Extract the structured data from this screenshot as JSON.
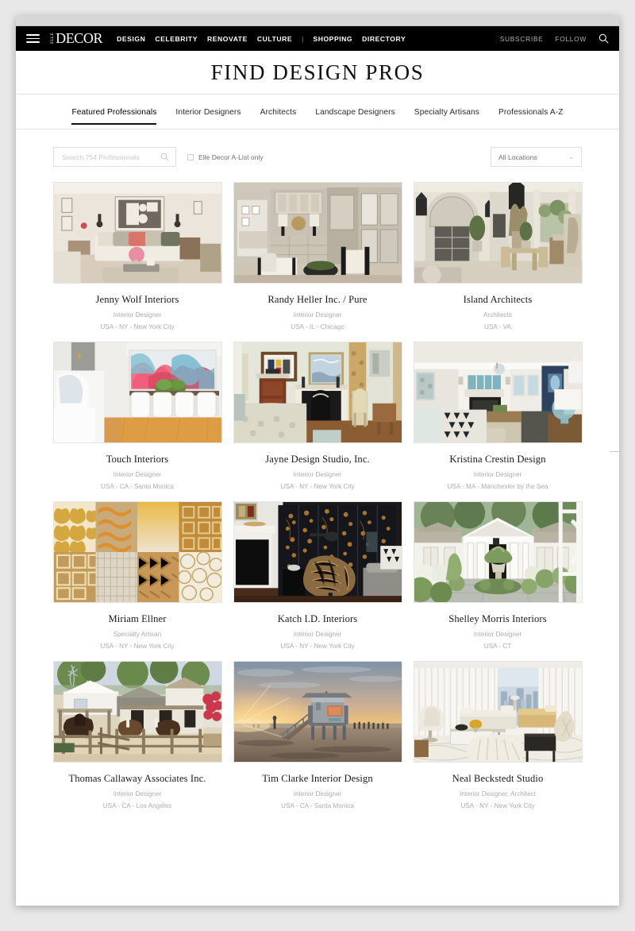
{
  "site": {
    "logo_primary": "DECOR",
    "logo_secondary": "ELLE",
    "menu_icon": "hamburger-icon",
    "search_icon": "search-icon"
  },
  "nav": {
    "links": [
      "DESIGN",
      "CELEBRITY",
      "RENOVATE",
      "CULTURE",
      "SHOPPING",
      "DIRECTORY"
    ],
    "divider": "|",
    "subscribe": "SUBSCRIBE",
    "follow": "FOLLOW"
  },
  "hero": {
    "title": "FIND DESIGN PROS"
  },
  "tabs": [
    {
      "label": "Featured Professionals",
      "active": true
    },
    {
      "label": "Interior Designers",
      "active": false
    },
    {
      "label": "Architects",
      "active": false
    },
    {
      "label": "Landscape Designers",
      "active": false
    },
    {
      "label": "Specialty Artisans",
      "active": false
    },
    {
      "label": "Professionals A-Z",
      "active": false
    }
  ],
  "filters": {
    "search_placeholder": "Search 754 Professionals",
    "search_value": "",
    "checkbox_label": "Elle Decor A-List only",
    "checkbox_checked": false,
    "location_value": "All Locations",
    "chevron": "⌄"
  },
  "cards": [
    {
      "name": "Jenny Wolf Interiors",
      "role": "Interior Designer",
      "location": "USA - NY - New York City",
      "image": "beige-living-room"
    },
    {
      "name": "Randy Heller Inc. / Pure",
      "role": "Interior Designer",
      "location": "USA - IL - Chicago",
      "image": "greige-dressing-room"
    },
    {
      "name": "Island Architects",
      "role": "Architects",
      "location": "USA - VA",
      "image": "covered-porch"
    },
    {
      "name": "Touch Interiors",
      "role": "Interior Designer",
      "location": "USA - CA - Santa Monica",
      "image": "abstract-art-dining"
    },
    {
      "name": "Jayne Design Studio, Inc.",
      "role": "Interior Designer",
      "location": "USA - NY - New York City",
      "image": "bedroom-fireplace"
    },
    {
      "name": "Kristina Crestin Design",
      "role": "Interior Designer",
      "location": "USA - MA - Manchester by the Sea",
      "image": "coastal-living-room"
    },
    {
      "name": "Miriam Ellner",
      "role": "Specialty Artisan",
      "location": "USA - NY - New York City",
      "image": "gold-textile-swatches"
    },
    {
      "name": "Katch I.D. Interiors",
      "role": "Interior Designer",
      "location": "USA - NY - New York City",
      "image": "lacquer-screen-fur-chaise"
    },
    {
      "name": "Shelley Morris Interiors",
      "role": "Interior Designer",
      "location": "USA - CT",
      "image": "white-portico-garden"
    },
    {
      "name": "Thomas Callaway Associates Inc.",
      "role": "Interior Designer",
      "location": "USA - CA - Los Angeles",
      "image": "ranch-stables"
    },
    {
      "name": "Tim Clarke Interior Design",
      "role": "Interior Designer",
      "location": "USA - CA - Santa Monica",
      "image": "beach-lifeguard-sunset"
    },
    {
      "name": "Neal Beckstedt Studio",
      "role": "Interior Designer, Architect",
      "location": "USA - NY - New York City",
      "image": "white-penthouse-living"
    }
  ],
  "colors": {
    "nav_background": "#000000",
    "page_background": "#ffffff",
    "text_primary": "#1a1a1a",
    "text_muted": "#adadad",
    "border": "#e0e0e0"
  }
}
